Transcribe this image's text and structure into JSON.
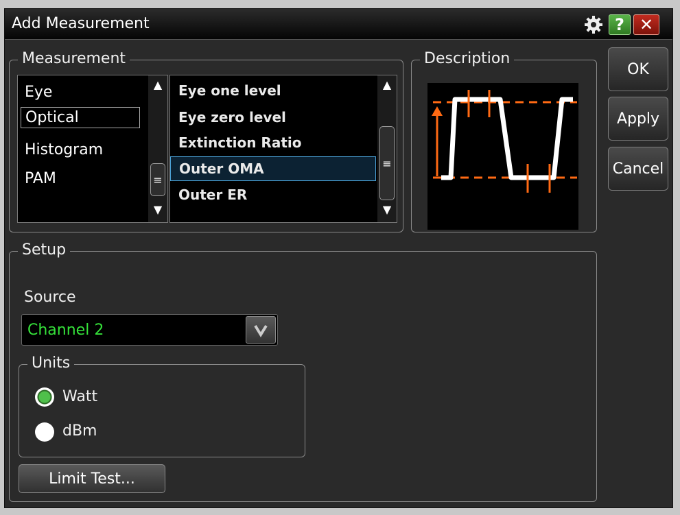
{
  "window": {
    "title": "Add Measurement"
  },
  "measurement": {
    "group_label": "Measurement",
    "categories": [
      "Eye",
      "Optical",
      "Histogram",
      "PAM"
    ],
    "selected_category": "Optical",
    "measurements": [
      "Eye one level",
      "Eye zero level",
      "Extinction Ratio",
      "Outer OMA",
      "Outer ER"
    ],
    "selected_measurement": "Outer OMA"
  },
  "description": {
    "group_label": "Description"
  },
  "buttons": {
    "ok": "OK",
    "apply": "Apply",
    "cancel": "Cancel"
  },
  "setup": {
    "group_label": "Setup",
    "source_label": "Source",
    "source_value": "Channel 2",
    "units_label": "Units",
    "units": [
      "Watt",
      "dBm"
    ],
    "selected_unit": "Watt",
    "limit_test": "Limit Test..."
  },
  "colors": {
    "accent": "#ff6a13",
    "selection": "#4aa1d6",
    "source_text": "#35e13a"
  },
  "icons": {
    "settings": "gear-icon",
    "help": "help-icon",
    "close": "close-icon"
  }
}
